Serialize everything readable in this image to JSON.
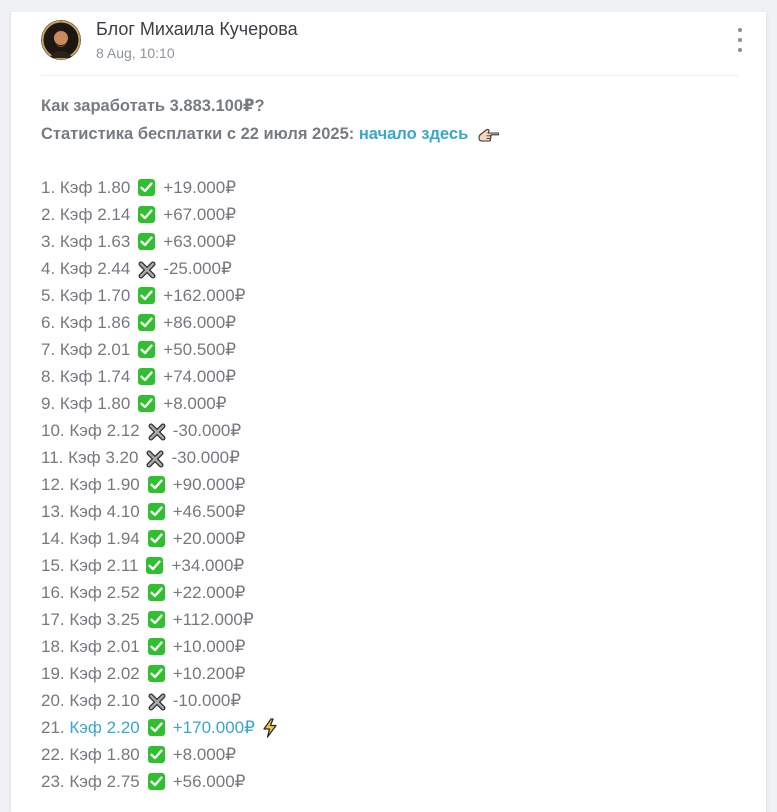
{
  "post": {
    "author": "Блог Михаила Кучерова",
    "date": "8 Aug, 10:10",
    "avatar_text": "МИХАИЛ КУЧЕРОВ",
    "headline": "Как заработать 3.883.100₽?",
    "stats_prefix": "Статистика бесплатки с 22 июля 2025: ",
    "stats_link": "начало здесь"
  },
  "colors": {
    "link": "#3aa6c9",
    "check_green": "#2fbf2f",
    "text": "#75797f"
  },
  "rows": [
    {
      "num": "1.",
      "kef": "Кэф 1.80",
      "result": "win",
      "amount": "+19.000₽"
    },
    {
      "num": "2.",
      "kef": "Кэф 2.14",
      "result": "win",
      "amount": "+67.000₽"
    },
    {
      "num": "3.",
      "kef": "Кэф 1.63",
      "result": "win",
      "amount": "+63.000₽"
    },
    {
      "num": "4.",
      "kef": "Кэф 2.44",
      "result": "loss",
      "amount": "-25.000₽"
    },
    {
      "num": "5.",
      "kef": "Кэф 1.70",
      "result": "win",
      "amount": "+162.000₽"
    },
    {
      "num": "6.",
      "kef": "Кэф 1.86",
      "result": "win",
      "amount": "+86.000₽"
    },
    {
      "num": "7.",
      "kef": "Кэф 2.01",
      "result": "win",
      "amount": "+50.500₽"
    },
    {
      "num": "8.",
      "kef": "Кэф 1.74",
      "result": "win",
      "amount": "+74.000₽"
    },
    {
      "num": "9.",
      "kef": "Кэф 1.80",
      "result": "win",
      "amount": "+8.000₽"
    },
    {
      "num": "10.",
      "kef": "Кэф 2.12",
      "result": "loss",
      "amount": "-30.000₽"
    },
    {
      "num": "11.",
      "kef": "Кэф 3.20",
      "result": "loss",
      "amount": "-30.000₽"
    },
    {
      "num": "12.",
      "kef": "Кэф 1.90",
      "result": "win",
      "amount": "+90.000₽"
    },
    {
      "num": "13.",
      "kef": "Кэф 4.10",
      "result": "win",
      "amount": "+46.500₽"
    },
    {
      "num": "14.",
      "kef": "Кэф 1.94",
      "result": "win",
      "amount": "+20.000₽"
    },
    {
      "num": "15.",
      "kef": "Кэф 2.11",
      "result": "win",
      "amount": "+34.000₽"
    },
    {
      "num": "16.",
      "kef": "Кэф 2.52",
      "result": "win",
      "amount": "+22.000₽"
    },
    {
      "num": "17.",
      "kef": "Кэф 3.25",
      "result": "win",
      "amount": "+112.000₽"
    },
    {
      "num": "18.",
      "kef": "Кэф 2.01",
      "result": "win",
      "amount": "+10.000₽"
    },
    {
      "num": "19.",
      "kef": "Кэф 2.02",
      "result": "win",
      "amount": "+10.200₽"
    },
    {
      "num": "20.",
      "kef": "Кэф 2.10",
      "result": "loss",
      "amount": "-10.000₽"
    },
    {
      "num": "21.",
      "kef": "Кэф 2.20",
      "result": "win",
      "amount": "+170.000₽",
      "link": true,
      "bolt": true
    },
    {
      "num": "22.",
      "kef": "Кэф 1.80",
      "result": "win",
      "amount": "+8.000₽"
    },
    {
      "num": "23.",
      "kef": "Кэф 2.75",
      "result": "win",
      "amount": "+56.000₽"
    }
  ]
}
